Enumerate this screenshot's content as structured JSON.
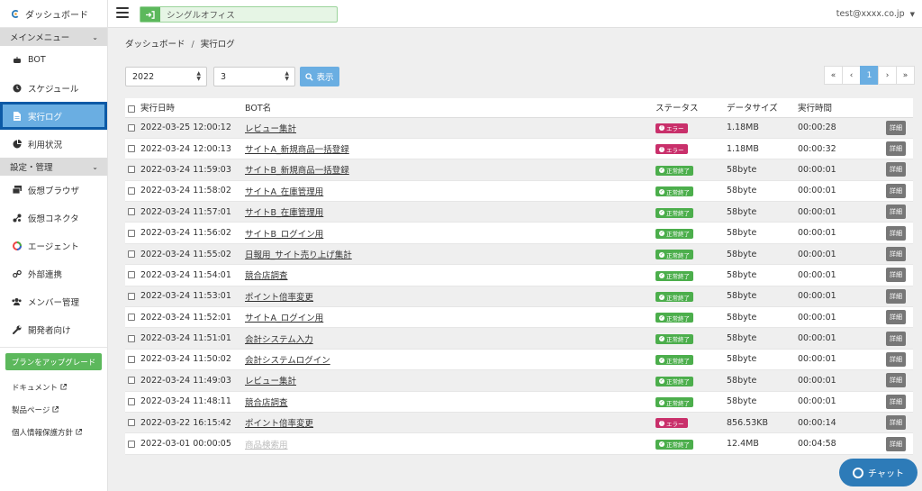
{
  "app": {
    "brand": "ダッシュボード"
  },
  "header": {
    "office": "シングルオフィス",
    "user": "test@xxxx.co.jp"
  },
  "sidebar": {
    "section_main": "メインメニュー",
    "items": [
      {
        "label": "BOT",
        "icon": "bot-icon"
      },
      {
        "label": "スケジュール",
        "icon": "clock-icon"
      },
      {
        "label": "実行ログ",
        "icon": "document-icon"
      },
      {
        "label": "利用状況",
        "icon": "pie-chart-icon"
      }
    ],
    "section_settings": "設定・管理",
    "settings_items": [
      {
        "label": "仮想ブラウザ",
        "icon": "browser-icon"
      },
      {
        "label": "仮想コネクタ",
        "icon": "connector-icon"
      },
      {
        "label": "エージェント",
        "icon": "agent-icon"
      },
      {
        "label": "外部連携",
        "icon": "link-icon"
      },
      {
        "label": "メンバー管理",
        "icon": "users-icon"
      },
      {
        "label": "開発者向け",
        "icon": "wrench-icon"
      }
    ],
    "upgrade": "プランをアップグレード",
    "links": [
      "ドキュメント",
      "製品ページ",
      "個人情報保護方針"
    ]
  },
  "breadcrumb": {
    "home": "ダッシュボード",
    "current": "実行ログ"
  },
  "filters": {
    "year": "2022",
    "month": "3",
    "show": "表示"
  },
  "pager": {
    "first": "«",
    "prev": "‹",
    "page": "1",
    "next": "›",
    "last": "»"
  },
  "table": {
    "headers": {
      "datetime": "実行日時",
      "bot": "BOT名",
      "status": "ステータス",
      "size": "データサイズ",
      "time": "実行時間"
    },
    "detail_label": "詳細",
    "status_labels": {
      "error": "エラー",
      "ok": "正常終了"
    },
    "rows": [
      {
        "datetime": "2022-03-25 12:00:12",
        "bot": "レビュー集計",
        "status": "error",
        "size": "1.18MB",
        "time": "00:00:28"
      },
      {
        "datetime": "2022-03-24 12:00:13",
        "bot": "サイトA_新規商品一括登録",
        "status": "error",
        "size": "1.18MB",
        "time": "00:00:32"
      },
      {
        "datetime": "2022-03-24 11:59:03",
        "bot": "サイトB_新規商品一括登録",
        "status": "ok",
        "size": "58byte",
        "time": "00:00:01"
      },
      {
        "datetime": "2022-03-24 11:58:02",
        "bot": "サイトA_在庫管理用",
        "status": "ok",
        "size": "58byte",
        "time": "00:00:01"
      },
      {
        "datetime": "2022-03-24 11:57:01",
        "bot": "サイトB_在庫管理用",
        "status": "ok",
        "size": "58byte",
        "time": "00:00:01"
      },
      {
        "datetime": "2022-03-24 11:56:02",
        "bot": "サイトB_ログイン用",
        "status": "ok",
        "size": "58byte",
        "time": "00:00:01"
      },
      {
        "datetime": "2022-03-24 11:55:02",
        "bot": "日報用_サイト売り上げ集計",
        "status": "ok",
        "size": "58byte",
        "time": "00:00:01"
      },
      {
        "datetime": "2022-03-24 11:54:01",
        "bot": "競合店調査",
        "status": "ok",
        "size": "58byte",
        "time": "00:00:01"
      },
      {
        "datetime": "2022-03-24 11:53:01",
        "bot": "ポイント倍率変更",
        "status": "ok",
        "size": "58byte",
        "time": "00:00:01"
      },
      {
        "datetime": "2022-03-24 11:52:01",
        "bot": "サイトA_ログイン用",
        "status": "ok",
        "size": "58byte",
        "time": "00:00:01"
      },
      {
        "datetime": "2022-03-24 11:51:01",
        "bot": "会計システム入力",
        "status": "ok",
        "size": "58byte",
        "time": "00:00:01"
      },
      {
        "datetime": "2022-03-24 11:50:02",
        "bot": "会計システムログイン",
        "status": "ok",
        "size": "58byte",
        "time": "00:00:01"
      },
      {
        "datetime": "2022-03-24 11:49:03",
        "bot": "レビュー集計",
        "status": "ok",
        "size": "58byte",
        "time": "00:00:01"
      },
      {
        "datetime": "2022-03-24 11:48:11",
        "bot": "競合店調査",
        "status": "ok",
        "size": "58byte",
        "time": "00:00:01"
      },
      {
        "datetime": "2022-03-22 16:15:42",
        "bot": "ポイント倍率変更",
        "status": "error",
        "size": "856.53KB",
        "time": "00:00:14"
      },
      {
        "datetime": "2022-03-01 00:00:05",
        "bot": "商品検索用",
        "status": "ok",
        "size": "12.4MB",
        "time": "00:04:58",
        "disabled": true
      }
    ]
  },
  "chat": {
    "label": "チャット"
  },
  "colors": {
    "accent": "#6aaee2",
    "active_border": "#0c5aa6",
    "success": "#4cae4c",
    "error": "#c9306b"
  }
}
